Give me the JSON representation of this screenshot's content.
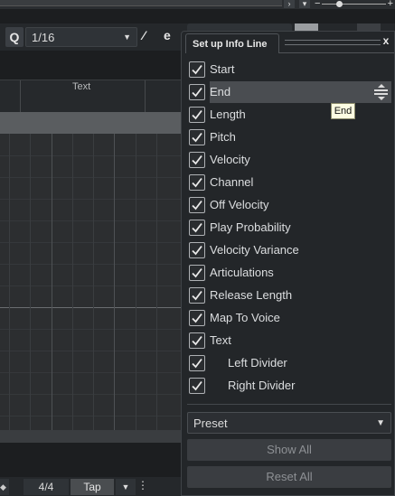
{
  "editor": {
    "quantize_button": "Q",
    "quantize_value": "1/16",
    "ruler_label": "Text",
    "time_signature": "4/4",
    "tap_label": "Tap"
  },
  "popup": {
    "title": "Set up Info Line",
    "close_label": "x",
    "tooltip": "End",
    "items": [
      {
        "label": "Start",
        "checked": true
      },
      {
        "label": "End",
        "checked": true
      },
      {
        "label": "Length",
        "checked": true
      },
      {
        "label": "Pitch",
        "checked": true
      },
      {
        "label": "Velocity",
        "checked": true
      },
      {
        "label": "Channel",
        "checked": true
      },
      {
        "label": "Off Velocity",
        "checked": true
      },
      {
        "label": "Play Probability",
        "checked": true
      },
      {
        "label": "Velocity Variance",
        "checked": true
      },
      {
        "label": "Articulations",
        "checked": true
      },
      {
        "label": "Release Length",
        "checked": true
      },
      {
        "label": "Map To Voice",
        "checked": true
      },
      {
        "label": "Text",
        "checked": true
      },
      {
        "label": "Left Divider",
        "checked": true
      },
      {
        "label": "Right Divider",
        "checked": true
      }
    ],
    "highlighted_item": "End",
    "preset_label": "Preset",
    "show_all_label": "Show All",
    "reset_all_label": "Reset All"
  }
}
